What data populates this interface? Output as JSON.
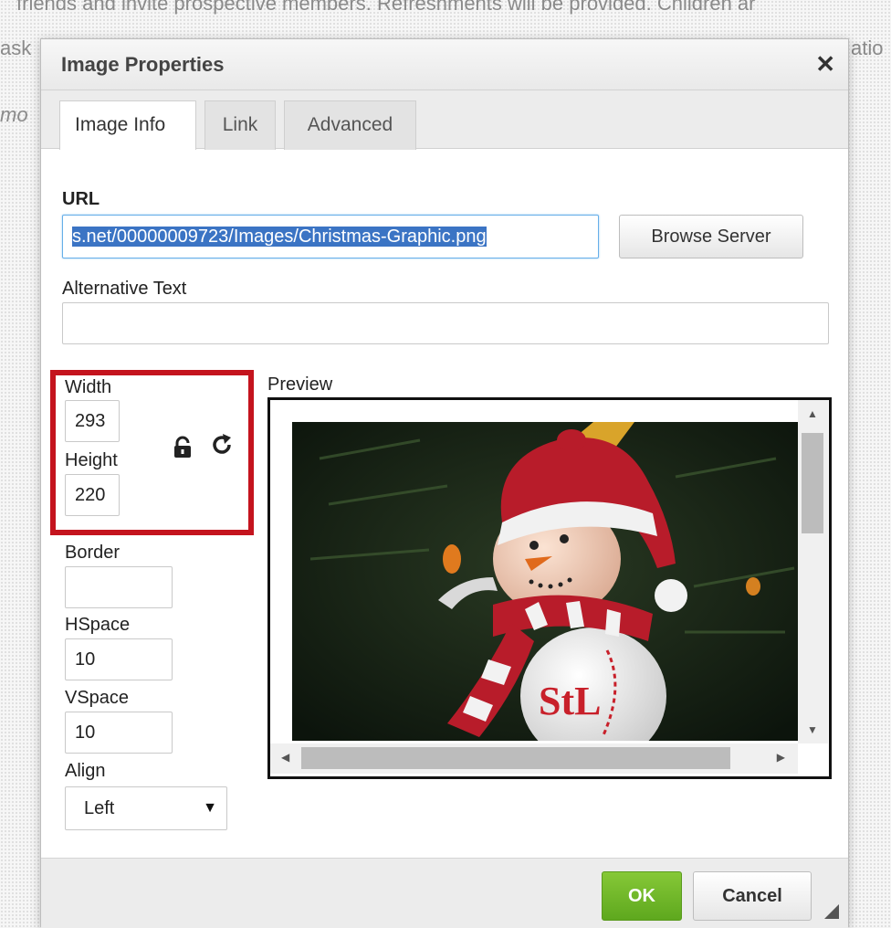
{
  "background": {
    "line1": "friends and invite prospective members. Refreshments will be provided. Children ar",
    "line2_left": "ask",
    "line2_right": "atio",
    "line3_left": "mo"
  },
  "dialog": {
    "title": "Image Properties",
    "tabs": [
      {
        "label": "Image Info",
        "active": true
      },
      {
        "label": "Link",
        "active": false
      },
      {
        "label": "Advanced",
        "active": false
      }
    ],
    "url": {
      "label": "URL",
      "value": "s.net/00000009723/Images/Christmas-Graphic.png",
      "browse_label": "Browse Server"
    },
    "alt_text": {
      "label": "Alternative Text",
      "value": ""
    },
    "width": {
      "label": "Width",
      "value": "293"
    },
    "height": {
      "label": "Height",
      "value": "220"
    },
    "border": {
      "label": "Border",
      "value": ""
    },
    "hspace": {
      "label": "HSpace",
      "value": "10"
    },
    "vspace": {
      "label": "VSpace",
      "value": "10"
    },
    "align": {
      "label": "Align",
      "value": "Left"
    },
    "preview": {
      "label": "Preview"
    },
    "footer": {
      "ok_label": "OK",
      "cancel_label": "Cancel"
    }
  },
  "colors": {
    "highlight_box": "#c4141e",
    "ok_button": "#6eb82a",
    "url_selection": "#3b74c4"
  },
  "icons": [
    "close-icon",
    "lock-icon",
    "reset-size-icon",
    "resize-handle-icon",
    "select-arrow-icon"
  ]
}
